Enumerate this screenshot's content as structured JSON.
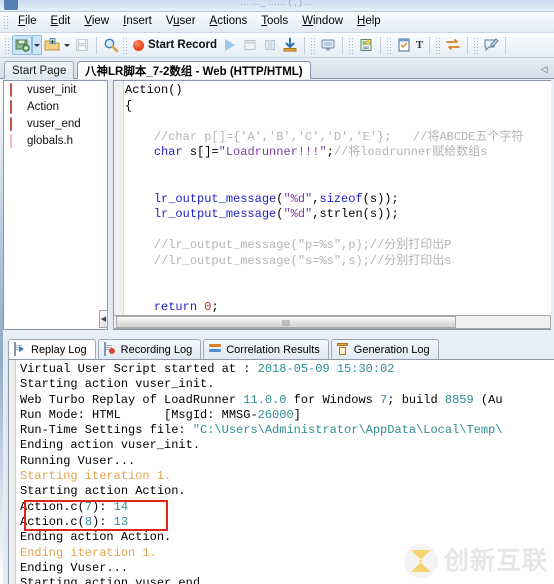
{
  "window": {
    "title_ghost": "…  …_  ……    (  ,  )   …"
  },
  "menu": {
    "items": [
      {
        "label": "File",
        "mnemonic": "F"
      },
      {
        "label": "Edit",
        "mnemonic": "E"
      },
      {
        "label": "View",
        "mnemonic": "V"
      },
      {
        "label": "Insert",
        "mnemonic": "I"
      },
      {
        "label": "Vuser",
        "mnemonic": "u"
      },
      {
        "label": "Actions",
        "mnemonic": "A"
      },
      {
        "label": "Tools",
        "mnemonic": "T"
      },
      {
        "label": "Window",
        "mnemonic": "W"
      },
      {
        "label": "Help",
        "mnemonic": "H"
      }
    ]
  },
  "toolbar": {
    "start_record_label": "Start Record",
    "buttons": [
      {
        "name": "save-script-icon"
      },
      {
        "name": "open-script-icon"
      },
      {
        "name": "save-all-icon"
      },
      {
        "name": "find-icon"
      },
      {
        "name": "run-icon"
      },
      {
        "name": "stop-icon"
      },
      {
        "name": "pause-icon"
      },
      {
        "name": "download-icon"
      },
      {
        "name": "runtime-settings-icon"
      },
      {
        "name": "new-step-icon"
      },
      {
        "name": "task-list-icon"
      },
      {
        "name": "text-check-icon"
      },
      {
        "name": "correlation-icon"
      },
      {
        "name": "comment-icon"
      }
    ]
  },
  "tabs": {
    "start_page": "Start Page",
    "active_script": "八神LR脚本_7-2数组 - Web (HTTP/HTML)",
    "scroll_left_icon": "◁"
  },
  "tree": {
    "items": [
      {
        "label": "vuser_init",
        "icon": "action-brick-icon",
        "faded": false
      },
      {
        "label": "Action",
        "icon": "action-brick-icon",
        "faded": false
      },
      {
        "label": "vuser_end",
        "icon": "action-brick-icon",
        "faded": false
      },
      {
        "label": "globals.h",
        "icon": "header-file-icon",
        "faded": true
      }
    ]
  },
  "editor": {
    "lines": [
      [
        {
          "t": "Action()",
          "c": "pl"
        }
      ],
      [
        {
          "t": "{",
          "c": "pl"
        }
      ],
      [
        {
          "t": "",
          "c": "pl"
        }
      ],
      [
        {
          "t": "    ",
          "c": "pl"
        },
        {
          "t": "//char p[]={'A','B','C','D','E'};   //将ABCDE五个字符",
          "c": "cm"
        }
      ],
      [
        {
          "t": "    ",
          "c": "pl"
        },
        {
          "t": "char",
          "c": "kw"
        },
        {
          "t": " s[]=",
          "c": "pl"
        },
        {
          "t": "\"Loadrunner!!!\"",
          "c": "str"
        },
        {
          "t": ";",
          "c": "pl"
        },
        {
          "t": "//将loadrunner赋给数组s",
          "c": "cm"
        }
      ],
      [
        {
          "t": "",
          "c": "pl"
        }
      ],
      [
        {
          "t": "",
          "c": "pl"
        }
      ],
      [
        {
          "t": "    ",
          "c": "pl"
        },
        {
          "t": "lr_output_message",
          "c": "fn"
        },
        {
          "t": "(",
          "c": "pl"
        },
        {
          "t": "\"%d\"",
          "c": "str"
        },
        {
          "t": ",",
          "c": "pl"
        },
        {
          "t": "sizeof",
          "c": "kw"
        },
        {
          "t": "(s));",
          "c": "pl"
        }
      ],
      [
        {
          "t": "    ",
          "c": "pl"
        },
        {
          "t": "lr_output_message",
          "c": "fn"
        },
        {
          "t": "(",
          "c": "pl"
        },
        {
          "t": "\"%d\"",
          "c": "str"
        },
        {
          "t": ",",
          "c": "pl"
        },
        {
          "t": "strlen(s));",
          "c": "pl"
        }
      ],
      [
        {
          "t": "",
          "c": "pl"
        }
      ],
      [
        {
          "t": "    ",
          "c": "pl"
        },
        {
          "t": "//lr_output_message(\"p=%s\",p);//分别打印出P",
          "c": "cm"
        }
      ],
      [
        {
          "t": "    ",
          "c": "pl"
        },
        {
          "t": "//lr_output_message(\"s=%s\",s);//分别打印出s",
          "c": "cm"
        }
      ],
      [
        {
          "t": "",
          "c": "pl"
        }
      ],
      [
        {
          "t": "",
          "c": "pl"
        }
      ],
      [
        {
          "t": "    ",
          "c": "pl"
        },
        {
          "t": "return",
          "c": "kw"
        },
        {
          "t": " ",
          "c": "pl"
        },
        {
          "t": "0",
          "c": "num"
        },
        {
          "t": ";",
          "c": "pl"
        }
      ],
      [
        {
          "t": "",
          "c": "pl"
        }
      ],
      [
        {
          "t": "}",
          "c": "pl"
        }
      ]
    ]
  },
  "log_tabs": [
    {
      "label": "Replay Log",
      "icon": "replay-log-icon",
      "selected": true
    },
    {
      "label": "Recording Log",
      "icon": "recording-log-icon",
      "selected": false
    },
    {
      "label": "Correlation Results",
      "icon": "correlation-results-icon",
      "selected": false
    },
    {
      "label": "Generation Log",
      "icon": "generation-log-icon",
      "selected": false
    }
  ],
  "log": {
    "lines": [
      [
        {
          "t": "Virtual User Script started at : ",
          "c": "lg-blk"
        },
        {
          "t": "2018-05-09 15:30:02",
          "c": "lg-num"
        }
      ],
      [
        {
          "t": "Starting action vuser_init.",
          "c": "lg-blk"
        }
      ],
      [
        {
          "t": "Web Turbo Replay of LoadRunner ",
          "c": "lg-blk"
        },
        {
          "t": "11.0.0",
          "c": "lg-num"
        },
        {
          "t": " for Windows ",
          "c": "lg-blk"
        },
        {
          "t": "7",
          "c": "lg-num"
        },
        {
          "t": "; build ",
          "c": "lg-blk"
        },
        {
          "t": "8859",
          "c": "lg-num"
        },
        {
          "t": " (Au",
          "c": "lg-blk"
        }
      ],
      [
        {
          "t": "Run Mode: HTML      [MsgId: MMSG-",
          "c": "lg-blk"
        },
        {
          "t": "26000",
          "c": "lg-num"
        },
        {
          "t": "]",
          "c": "lg-blk"
        }
      ],
      [
        {
          "t": "Run-Time Settings file: ",
          "c": "lg-blk"
        },
        {
          "t": "\"C:\\Users\\Administrator\\AppData\\Local\\Temp\\",
          "c": "lg-num"
        }
      ],
      [
        {
          "t": "Ending action vuser_init.",
          "c": "lg-blk"
        }
      ],
      [
        {
          "t": "Running Vuser...",
          "c": "lg-blk"
        }
      ],
      [
        {
          "t": "Starting iteration 1.",
          "c": "lg-warn"
        }
      ],
      [
        {
          "t": "Starting action Action.",
          "c": "lg-blk"
        }
      ],
      [
        {
          "t": "Action.c(",
          "c": "lg-blk"
        },
        {
          "t": "7",
          "c": "lg-num"
        },
        {
          "t": "): ",
          "c": "lg-blk"
        },
        {
          "t": "14",
          "c": "lg-num"
        }
      ],
      [
        {
          "t": "Action.c(",
          "c": "lg-blk"
        },
        {
          "t": "8",
          "c": "lg-num"
        },
        {
          "t": "): ",
          "c": "lg-blk"
        },
        {
          "t": "13",
          "c": "lg-num"
        }
      ],
      [
        {
          "t": "Ending action Action.",
          "c": "lg-blk"
        }
      ],
      [
        {
          "t": "Ending iteration 1.",
          "c": "lg-warn"
        }
      ],
      [
        {
          "t": "Ending Vuser...",
          "c": "lg-blk"
        }
      ],
      [
        {
          "t": "Starting action vuser_end.",
          "c": "lg-blk"
        }
      ]
    ],
    "highlight_color": "#e1251b"
  },
  "watermark": {
    "text": "创新互联"
  }
}
